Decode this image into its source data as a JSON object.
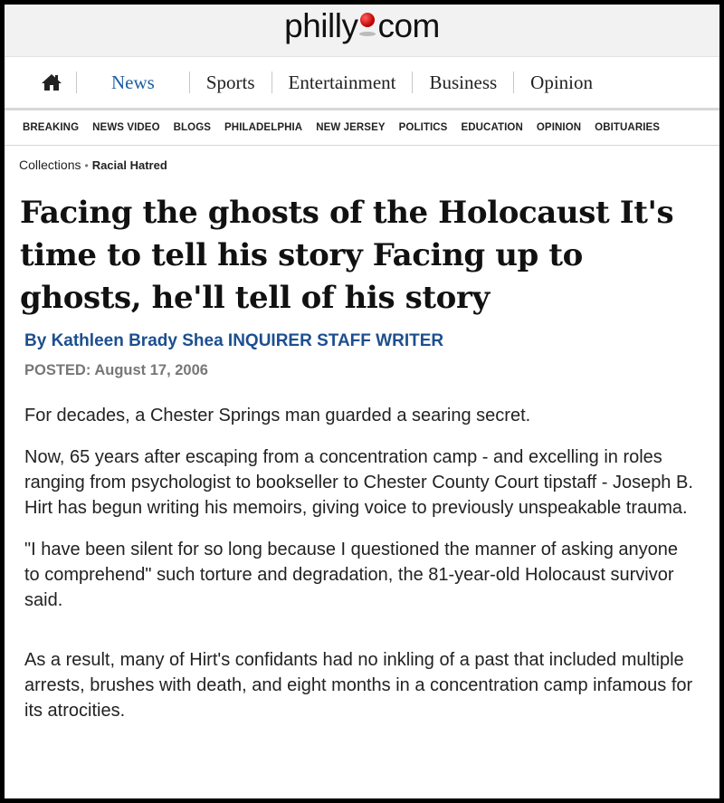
{
  "site": {
    "logo_left": "philly",
    "logo_right": "com"
  },
  "main_nav": {
    "home_icon": "home-icon",
    "items": [
      "News",
      "Sports",
      "Entertainment",
      "Business",
      "Opinion"
    ],
    "active": "News",
    "active_color": "#1d5da3"
  },
  "sub_nav": {
    "items": [
      "BREAKING",
      "NEWS VIDEO",
      "BLOGS",
      "PHILADELPHIA",
      "NEW JERSEY",
      "POLITICS",
      "EDUCATION",
      "OPINION",
      "OBITUARIES"
    ]
  },
  "breadcrumb": {
    "root": "Collections",
    "separator": "•",
    "current": "Racial Hatred"
  },
  "article": {
    "headline": "Facing the ghosts of the Holocaust It's time to tell his story Facing up to ghosts, he'll tell of his story",
    "byline": "By Kathleen Brady Shea INQUIRER STAFF WRITER",
    "byline_color": "#1c4f8f",
    "posted_label": "POSTED:",
    "posted_date": "August 17, 2006",
    "paragraphs": [
      "For decades, a Chester Springs man guarded a searing secret.",
      "Now, 65 years after escaping from a concentration camp - and excelling in roles ranging from psychologist to bookseller to Chester County Court tipstaff - Joseph B. Hirt has begun writing his memoirs, giving voice to previously unspeakable trauma.",
      "\"I have been silent for so long because I questioned the manner of asking anyone to comprehend\" such torture and degradation, the 81-year-old Holocaust survivor said.",
      "As a result, many of Hirt's confidants had no inkling of a past that included multiple arrests, brushes with death, and eight months in a concentration camp infamous for its atrocities."
    ]
  }
}
